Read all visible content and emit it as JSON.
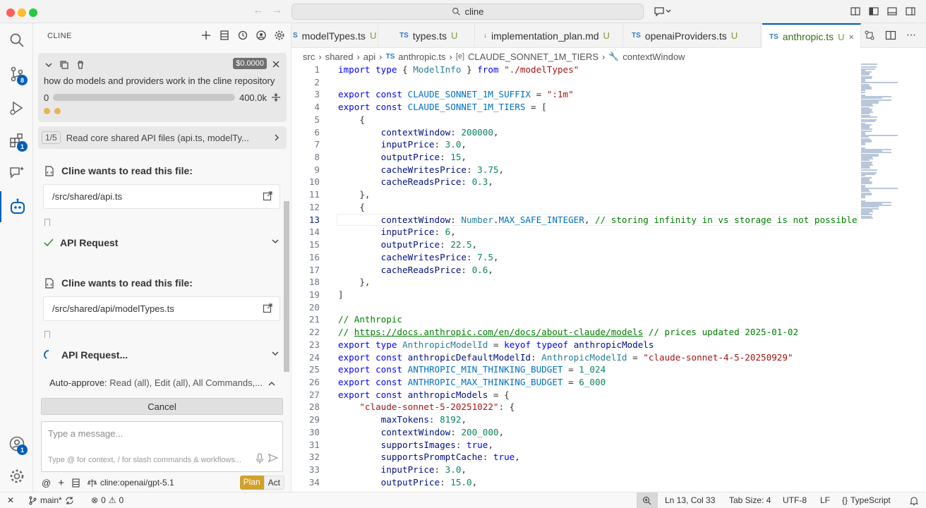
{
  "titlebar": {
    "search": "cline"
  },
  "activitybar": {
    "items": [
      {
        "name": "explorer",
        "badge": ""
      },
      {
        "name": "source-control",
        "badge": "8"
      },
      {
        "name": "run-debug",
        "badge": ""
      },
      {
        "name": "extensions",
        "badge": "1"
      },
      {
        "name": "remote-chat",
        "badge": ""
      },
      {
        "name": "cline",
        "badge": ""
      }
    ],
    "accounts_badge": "1"
  },
  "sidebar": {
    "header": "CLINE",
    "task": {
      "cost": "$0.0000",
      "text": "how do models and providers work in the cline repository",
      "context_used": "0",
      "context_max": "400.0k"
    },
    "step": {
      "count": "1/5",
      "text": "Read core shared API files (api.ts, modelTy..."
    },
    "read1": {
      "title": "Cline wants to read this file:",
      "path": "/src/shared/api.ts"
    },
    "api1": {
      "label": "API Request"
    },
    "read2": {
      "title": "Cline wants to read this file:",
      "path": "/src/shared/api/modelTypes.ts"
    },
    "api2": {
      "label": "API Request..."
    },
    "auto_approve": {
      "label": "Auto-approve:",
      "value": "Read (all), Edit (all), All Commands,..."
    },
    "cancel": "Cancel",
    "message": {
      "placeholder": "Type a message...",
      "hint": "Type @ for context, / for slash commands & workflows..."
    },
    "model": "cline:openai/gpt-5.1",
    "mode_plan": "Plan",
    "mode_act": "Act"
  },
  "tabs": [
    {
      "label": "modelTypes.ts",
      "status": "U",
      "prefix": "S"
    },
    {
      "label": "types.ts",
      "status": "U",
      "prefix": "TS"
    },
    {
      "label": "implementation_plan.md",
      "status": "U",
      "prefix": "↓"
    },
    {
      "label": "openaiProviders.ts",
      "status": "U",
      "prefix": "TS"
    },
    {
      "label": "anthropic.ts",
      "status": "U",
      "prefix": "TS",
      "active": true
    }
  ],
  "breadcrumb": [
    "src",
    "shared",
    "api",
    "anthropic.ts",
    "CLAUDE_SONNET_1M_TIERS",
    "contextWindow"
  ],
  "editor": {
    "current_line": 13,
    "lines": [
      {
        "n": "1",
        "t": "import type { ModelInfo } from \"./modelTypes\""
      },
      {
        "n": "2",
        "t": ""
      },
      {
        "n": "3",
        "t": "export const CLAUDE_SONNET_1M_SUFFIX = \":1m\""
      },
      {
        "n": "4",
        "t": "export const CLAUDE_SONNET_1M_TIERS = ["
      },
      {
        "n": "5",
        "t": "    {"
      },
      {
        "n": "6",
        "t": "        contextWindow: 200000,"
      },
      {
        "n": "7",
        "t": "        inputPrice: 3.0,"
      },
      {
        "n": "8",
        "t": "        outputPrice: 15,"
      },
      {
        "n": "9",
        "t": "        cacheWritesPrice: 3.75,"
      },
      {
        "n": "10",
        "t": "        cacheReadsPrice: 0.3,"
      },
      {
        "n": "11",
        "t": "    },"
      },
      {
        "n": "12",
        "t": "    {"
      },
      {
        "n": "13",
        "t": "        contextWindow: Number.MAX_SAFE_INTEGER, // storing infinity in vs storage is not possible, it co"
      },
      {
        "n": "14",
        "t": "        inputPrice: 6,"
      },
      {
        "n": "15",
        "t": "        outputPrice: 22.5,"
      },
      {
        "n": "16",
        "t": "        cacheWritesPrice: 7.5,"
      },
      {
        "n": "17",
        "t": "        cacheReadsPrice: 0.6,"
      },
      {
        "n": "18",
        "t": "    },"
      },
      {
        "n": "19",
        "t": "]"
      },
      {
        "n": "20",
        "t": ""
      },
      {
        "n": "21",
        "t": "// Anthropic"
      },
      {
        "n": "22",
        "t": "// https://docs.anthropic.com/en/docs/about-claude/models // prices updated 2025-01-02"
      },
      {
        "n": "23",
        "t": "export type AnthropicModelId = keyof typeof anthropicModels"
      },
      {
        "n": "24",
        "t": "export const anthropicDefaultModelId: AnthropicModelId = \"claude-sonnet-4-5-20250929\""
      },
      {
        "n": "25",
        "t": "export const ANTHROPIC_MIN_THINKING_BUDGET = 1_024"
      },
      {
        "n": "26",
        "t": "export const ANTHROPIC_MAX_THINKING_BUDGET = 6_000"
      },
      {
        "n": "27",
        "t": "export const anthropicModels = {"
      },
      {
        "n": "28",
        "t": "    \"claude-sonnet-5-20251022\": {"
      },
      {
        "n": "29",
        "t": "        maxTokens: 8192,"
      },
      {
        "n": "30",
        "t": "        contextWindow: 200_000,"
      },
      {
        "n": "31",
        "t": "        supportsImages: true,"
      },
      {
        "n": "32",
        "t": "        supportsPromptCache: true,"
      },
      {
        "n": "33",
        "t": "        inputPrice: 3.0,"
      },
      {
        "n": "34",
        "t": "        outputPrice: 15.0,"
      }
    ]
  },
  "statusbar": {
    "branch": "main*",
    "errors": "0",
    "warnings": "0",
    "position": "Ln 13, Col 33",
    "tab_size": "Tab Size: 4",
    "encoding": "UTF-8",
    "eol": "LF",
    "language": "TypeScript"
  },
  "colors": {
    "accent": "#005fb8",
    "plan": "#d2a12b",
    "keyword": "#0000ff",
    "string": "#a31515",
    "number": "#098658",
    "comment": "#008000"
  }
}
